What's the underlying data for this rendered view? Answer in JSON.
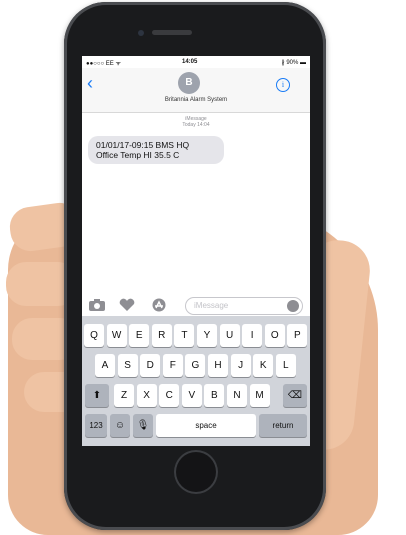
{
  "status_bar": {
    "carrier": "●●○○○ EE ᯤ",
    "time": "14:05",
    "battery": "∦ 90% ▬"
  },
  "nav": {
    "back_icon": "chevron-left",
    "avatar_initial": "B",
    "contact_name": "Britannia Alarm System",
    "info_icon": "info"
  },
  "thread": {
    "service": "iMessage",
    "timestamp": "Today 14:04",
    "messages": [
      {
        "line1": "01/01/17-09:15 BMS HQ",
        "line2": "Office Temp HI 35.5 C"
      }
    ]
  },
  "composer": {
    "placeholder": "iMessage",
    "icons": [
      "camera-icon",
      "digital-touch-icon",
      "app-store-icon",
      "mic-icon"
    ]
  },
  "keyboard": {
    "row1": [
      "Q",
      "W",
      "E",
      "R",
      "T",
      "Y",
      "U",
      "I",
      "O",
      "P"
    ],
    "row2": [
      "A",
      "S",
      "D",
      "F",
      "G",
      "H",
      "J",
      "K",
      "L"
    ],
    "row3": [
      "Z",
      "X",
      "C",
      "V",
      "B",
      "N",
      "M"
    ],
    "numbers_label": "123",
    "space_label": "space",
    "return_label": "return"
  }
}
